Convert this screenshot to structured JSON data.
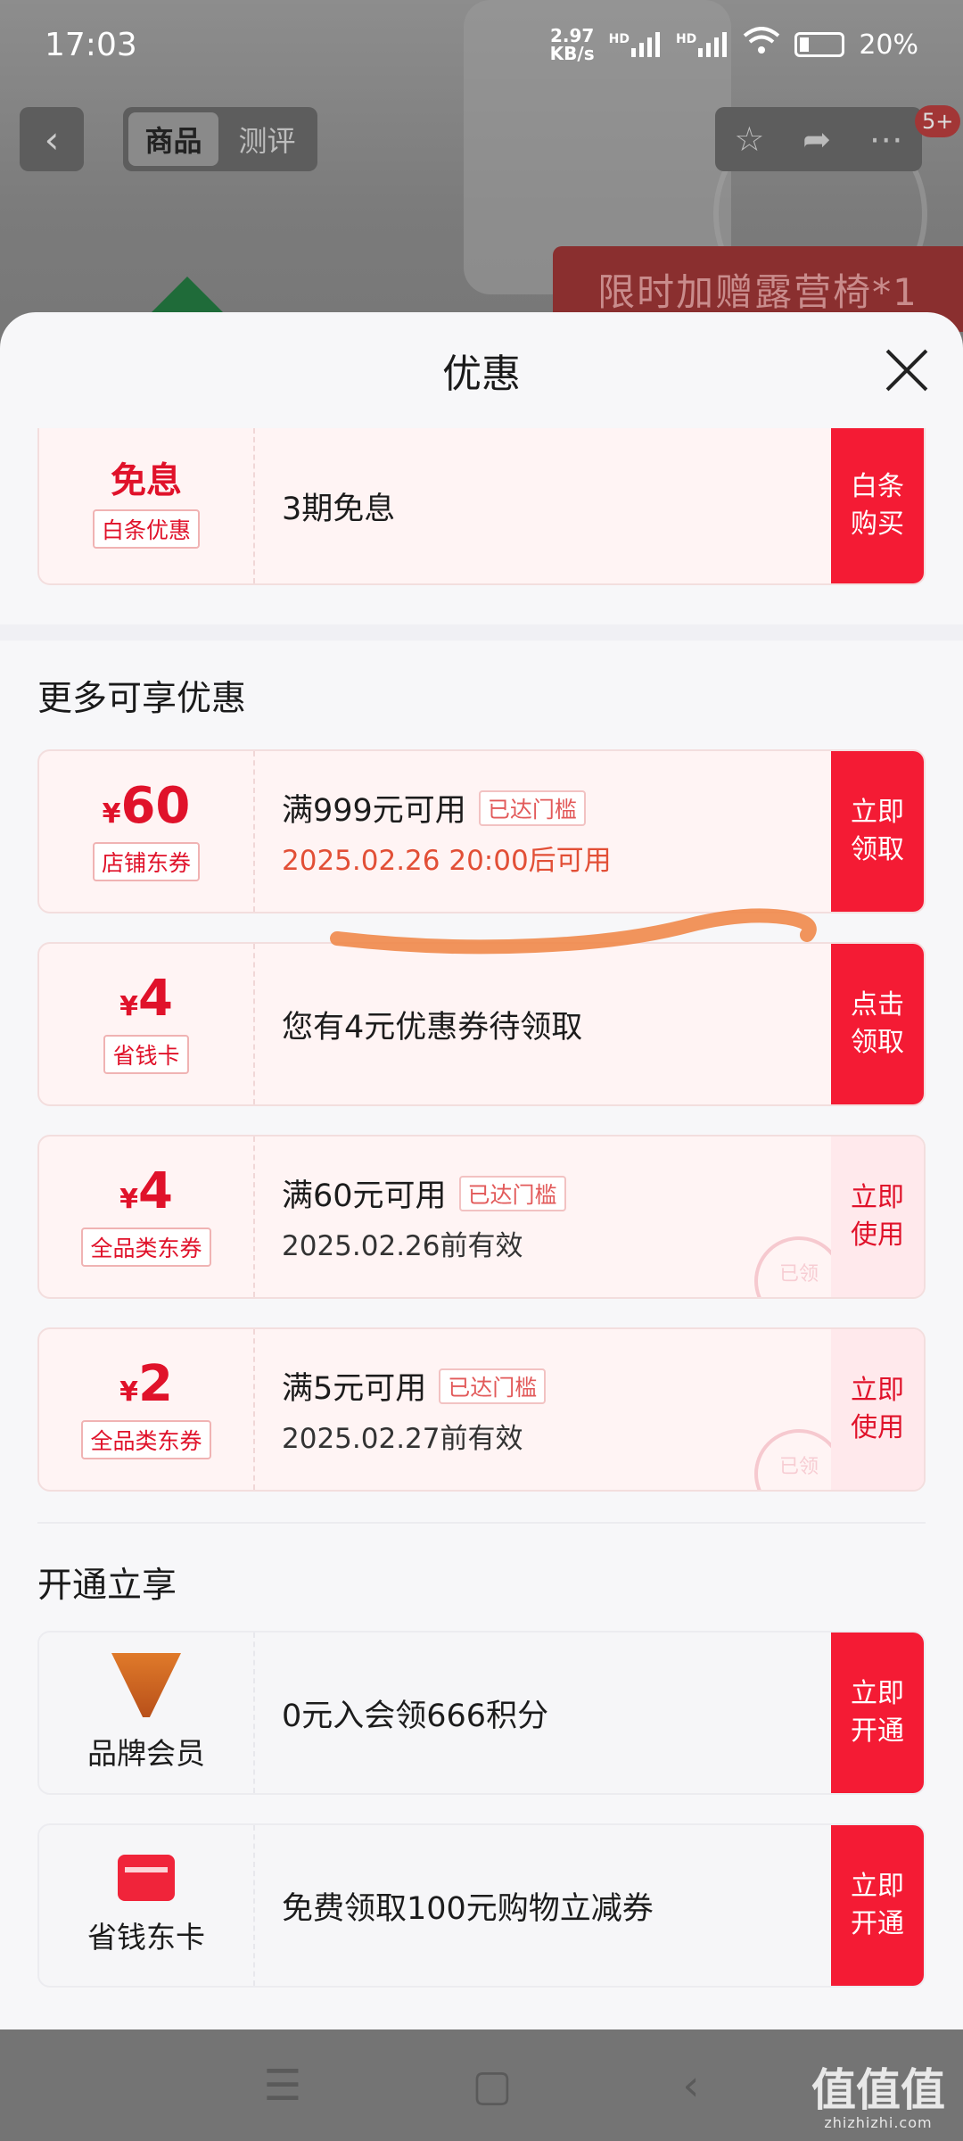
{
  "status_bar": {
    "time": "17:03",
    "net_speed": "2.97\nKB/s",
    "hd1": "HD",
    "hd2": "HD",
    "battery": "20%"
  },
  "nav": {
    "back": "‹",
    "tabs": [
      "商品",
      "测评"
    ],
    "badge": "5+"
  },
  "background": {
    "promo_banner": "限时加赠露营椅*1"
  },
  "sheet": {
    "title": "优惠"
  },
  "baitiao": {
    "amount": "免息",
    "tag": "白条优惠",
    "desc": "3期免息",
    "action": "白条\n购买"
  },
  "more_section": {
    "title": "更多可享优惠"
  },
  "coupons": [
    {
      "currency": "¥",
      "value": "60",
      "tag": "店铺东券",
      "line1": "满999元可用",
      "badge": "已达门槛",
      "line2": "2025.02.26 20:00后可用",
      "action": "立即\n领取"
    },
    {
      "currency": "¥",
      "value": "4",
      "tag": "省钱卡",
      "line1": "您有4元优惠券待领取",
      "action": "点击\n领取"
    },
    {
      "currency": "¥",
      "value": "4",
      "tag": "全品类东券",
      "line1": "满60元可用",
      "badge": "已达门槛",
      "line2": "2025.02.26前有效",
      "action": "立即\n使用",
      "stamp": "已领"
    },
    {
      "currency": "¥",
      "value": "2",
      "tag": "全品类东券",
      "line1": "满5元可用",
      "badge": "已达门槛",
      "line2": "2025.02.27前有效",
      "action": "立即\n使用",
      "stamp": "已领"
    }
  ],
  "join_section": {
    "title": "开通立享"
  },
  "memberships": [
    {
      "name": "品牌会员",
      "desc": "0元入会领666积分",
      "action": "立即\n开通"
    },
    {
      "name": "省钱东卡",
      "desc": "免费领取100元购物立减券",
      "action": "立即\n开通"
    }
  ],
  "watermark": {
    "text": "值值值",
    "sub": "zhizhizhi.com"
  },
  "colors": {
    "accent": "#f41b34",
    "price": "#e0122a"
  }
}
